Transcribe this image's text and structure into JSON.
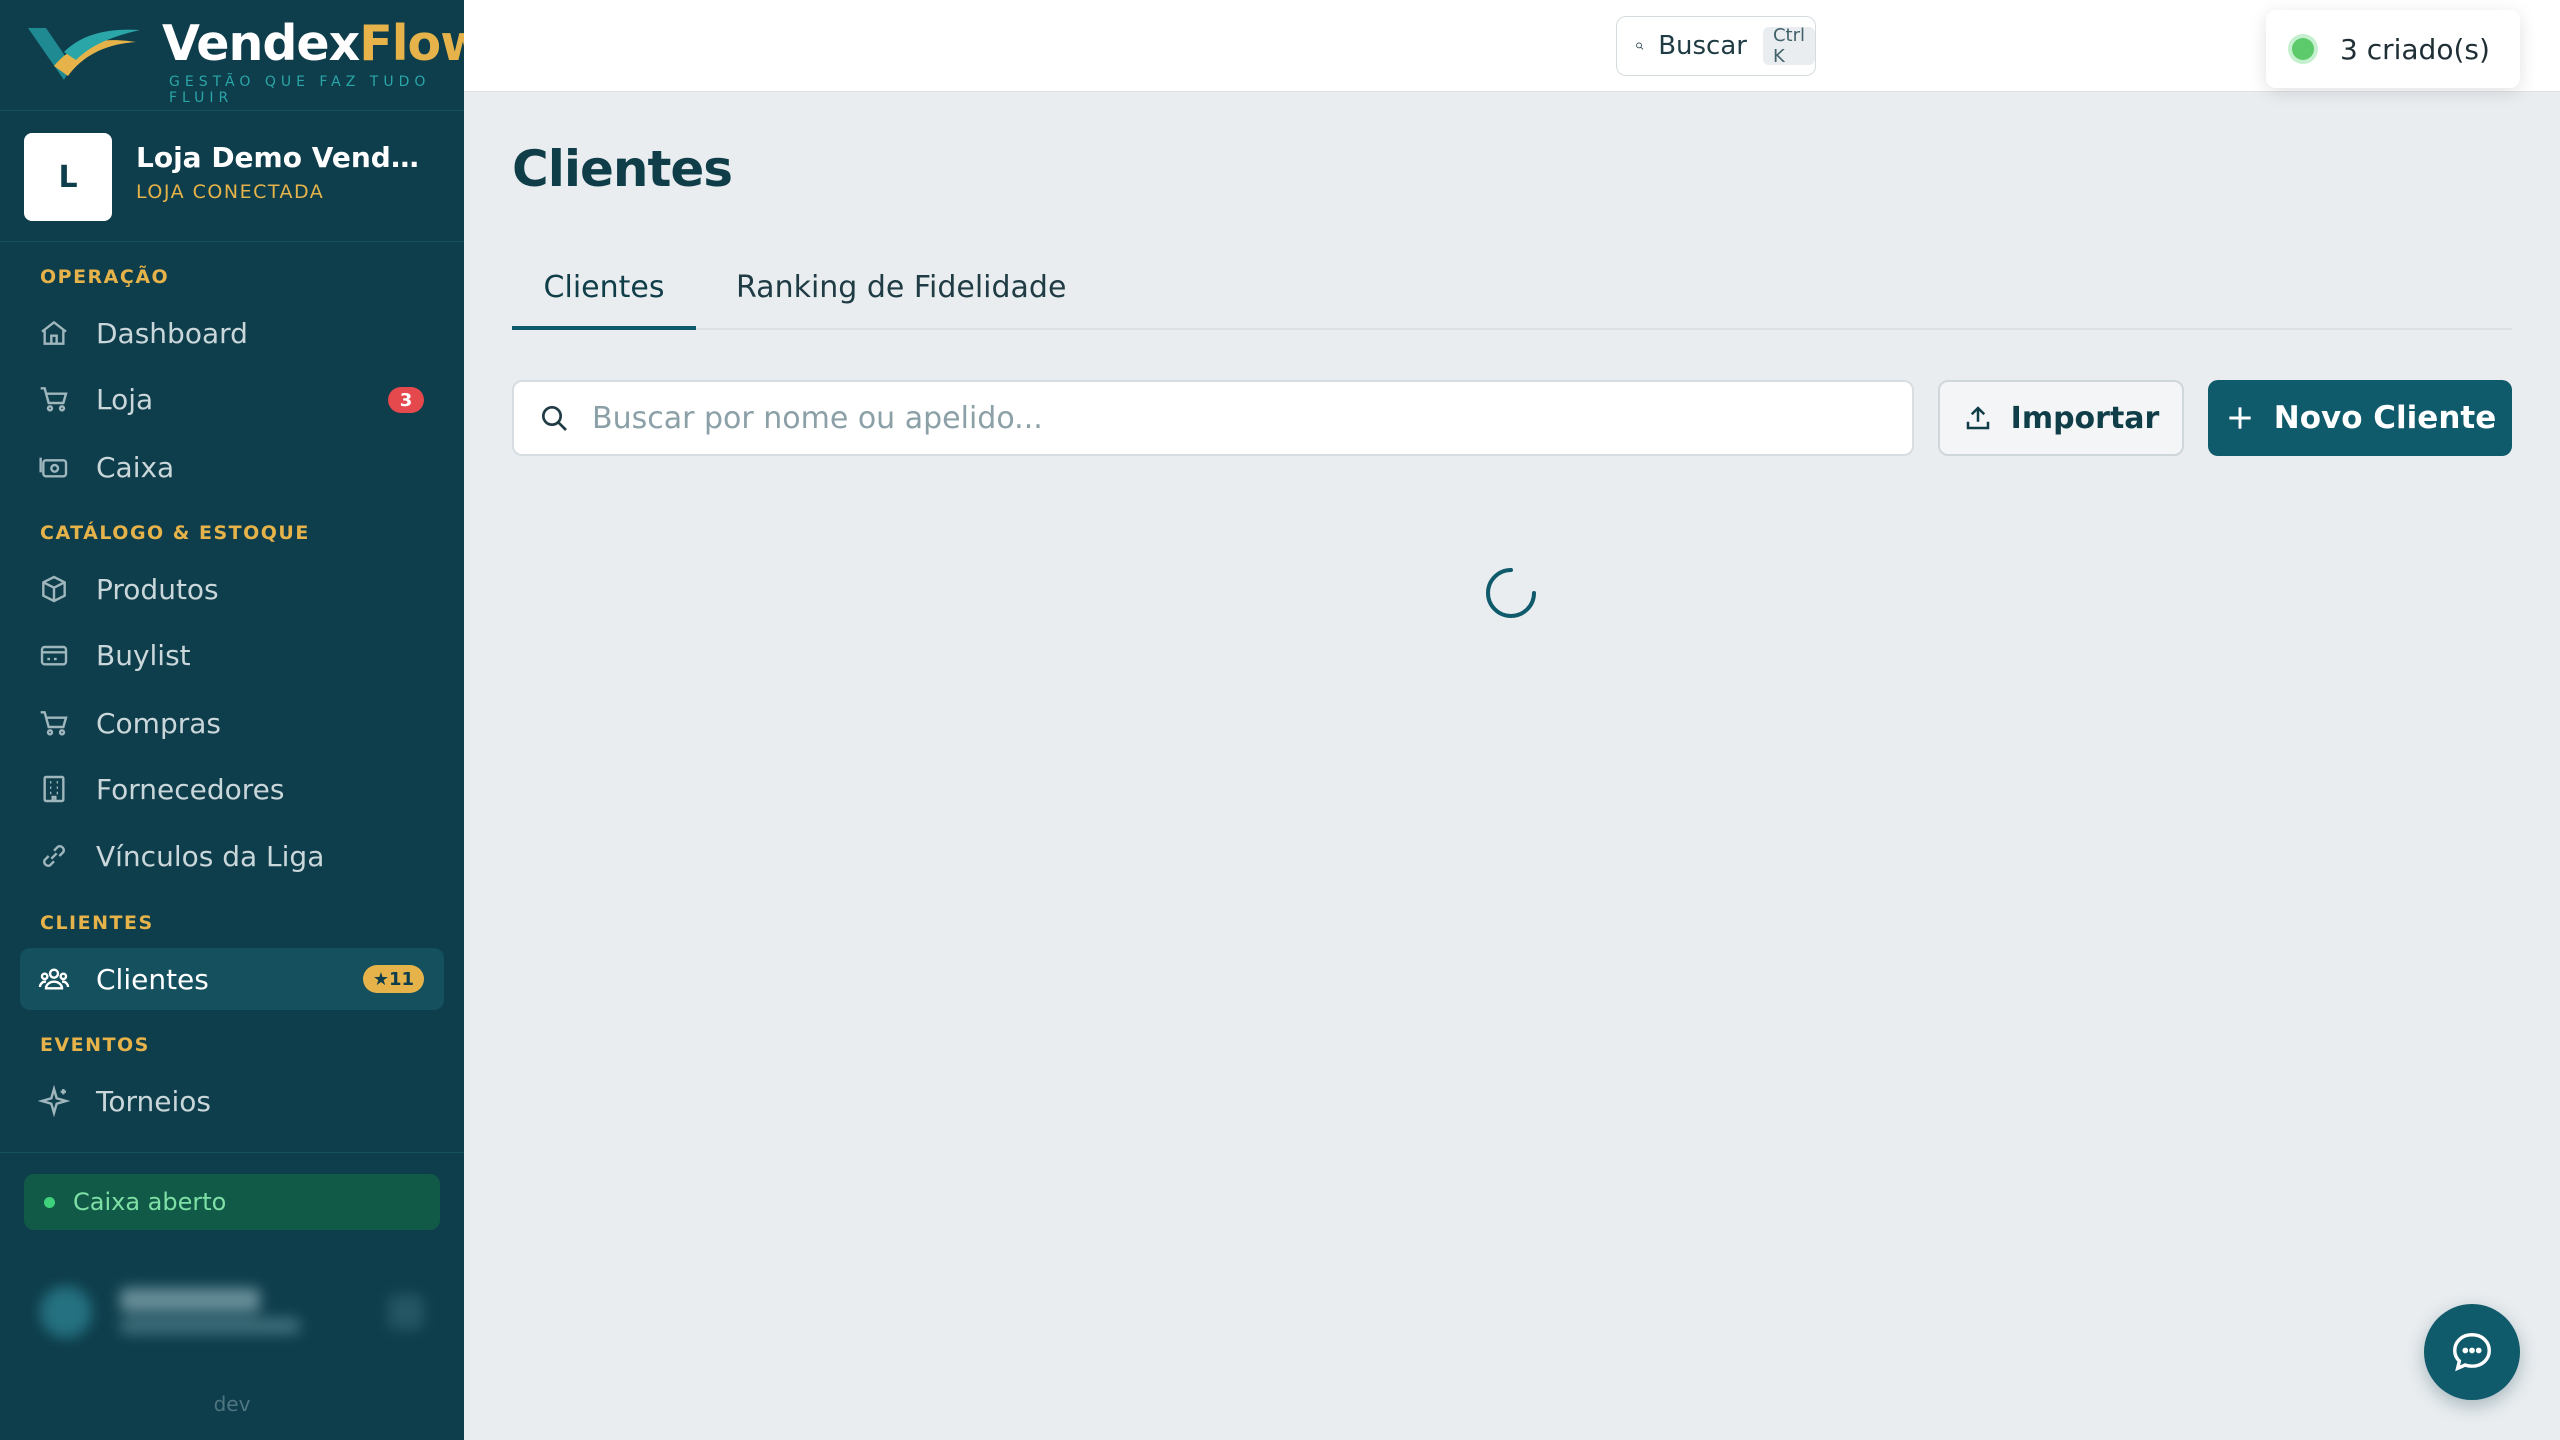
{
  "brand": {
    "name_part1": "Vendex",
    "name_part2": "Flow",
    "tagline": "GESTÃO QUE FAZ TUDO FLUIR"
  },
  "store": {
    "avatar_letter": "L",
    "name": "Loja Demo VendexFlow",
    "status": "LOJA CONECTADA"
  },
  "sidebar": {
    "sections": {
      "operacao": "OPERAÇÃO",
      "catalogo": "CATÁLOGO & ESTOQUE",
      "clientes": "CLIENTES",
      "eventos": "EVENTOS"
    },
    "items": {
      "dashboard": {
        "label": "Dashboard",
        "icon": "home-icon"
      },
      "loja": {
        "label": "Loja",
        "icon": "cart-icon",
        "badge": "3"
      },
      "caixa": {
        "label": "Caixa",
        "icon": "cash-icon"
      },
      "produtos": {
        "label": "Produtos",
        "icon": "box-icon"
      },
      "buylist": {
        "label": "Buylist",
        "icon": "card-icon"
      },
      "compras": {
        "label": "Compras",
        "icon": "cart-icon"
      },
      "fornecedores": {
        "label": "Fornecedores",
        "icon": "building-icon"
      },
      "vinculos": {
        "label": "Vínculos da Liga",
        "icon": "link-icon"
      },
      "clientes": {
        "label": "Clientes",
        "icon": "users-icon",
        "badge": "★11"
      },
      "torneios": {
        "label": "Torneios",
        "icon": "sparkle-icon"
      }
    },
    "cash_status": "Caixa aberto",
    "env": "dev"
  },
  "topbar": {
    "search_label": "Buscar",
    "search_shortcut": "Ctrl K",
    "toast_text": "3 criado(s)"
  },
  "main": {
    "title": "Clientes",
    "tabs": [
      {
        "label": "Clientes",
        "active": true
      },
      {
        "label": "Ranking de Fidelidade",
        "active": false
      }
    ],
    "search_placeholder": "Buscar por nome ou apelido...",
    "import_label": "Importar",
    "new_label": "Novo Cliente",
    "loading": true
  },
  "colors": {
    "sidebar_bg": "#0e3d4b",
    "accent": "#0f5a6b",
    "gold": "#e6b34a",
    "page_bg": "#e9edf0"
  }
}
